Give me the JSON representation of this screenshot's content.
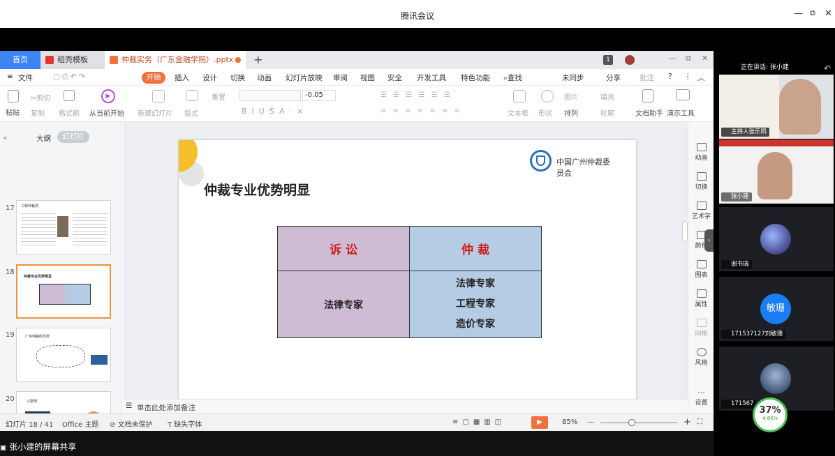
{
  "window": {
    "title": "腾讯会议"
  },
  "tabs": {
    "home": "首页",
    "template": "稻壳模板",
    "document": "仲裁实务（广东金融学院）.pptx"
  },
  "menu": {
    "file": "文件",
    "items": [
      "开始",
      "插入",
      "设计",
      "切换",
      "动画",
      "幻灯片放映",
      "审阅",
      "视图",
      "安全",
      "开发工具",
      "特色功能",
      "查找"
    ],
    "right": [
      "未同步",
      "分享",
      "批注"
    ]
  },
  "ribbon": {
    "paste": "粘贴",
    "cut": "剪切",
    "copy": "复制",
    "format_painter": "格式刷",
    "from_current": "从当前开始",
    "new_slide": "新建幻灯片",
    "layout": "版式",
    "reset": "重置",
    "font_size": "-0.05",
    "textbox": "文本框",
    "shape": "形状",
    "arrange": "排列",
    "picture": "图片",
    "fill": "填充",
    "outline": "轮廓",
    "doc_assistant": "文档助手",
    "present_tool": "演示工具"
  },
  "left_panel": {
    "tabs": [
      "大纲",
      "幻灯片"
    ],
    "thumbnails": [
      {
        "num": "17",
        "title": "三种仲裁员"
      },
      {
        "num": "18",
        "title": "仲裁专业优势明显"
      },
      {
        "num": "19",
        "title": "广州仲裁的优势"
      },
      {
        "num": "20",
        "title": "小案例"
      }
    ]
  },
  "slide": {
    "title": "仲裁专业优势明显",
    "logo_text_line1": "中国广州仲裁委",
    "logo_text_line2": "员会",
    "table": {
      "head_left": "诉 讼",
      "head_right": "仲 裁",
      "body_left": "法律专家",
      "body_right": [
        "法律专家",
        "工程专家",
        "造价专家"
      ]
    }
  },
  "right_bar": [
    "动画",
    "切换",
    "艺术字",
    "颜色",
    "图表",
    "属性",
    "网格",
    "风格",
    "设置"
  ],
  "notes": {
    "placeholder": "单击此处添加备注"
  },
  "status": {
    "slide_count": "幻灯片 18 / 41",
    "theme": "Office 主题",
    "protect": "文档未保护",
    "font_missing": "缺失字体",
    "zoom": "85%"
  },
  "meeting": {
    "speaking": "正在讲话: 张小建",
    "participants": [
      {
        "name": "主持人张乐凯",
        "type": "video"
      },
      {
        "name": "张小建",
        "type": "video"
      },
      {
        "name": "谢书瑞",
        "type": "avatar"
      },
      {
        "name": "171537127刘敏珊",
        "type": "avatar",
        "initials": "敏珊"
      },
      {
        "name": "171567",
        "type": "avatar"
      }
    ],
    "cpu_percent": "37%",
    "net_speed": "4.6K/s"
  },
  "screen_share": {
    "label": "张小建的屏幕共享"
  },
  "colors": {
    "accent_orange": "#f0723b",
    "home_tab_blue": "#3d84f5",
    "table_purple": "#cdbcd4",
    "table_blue": "#b5cde4",
    "head_red": "#d21a1a"
  }
}
